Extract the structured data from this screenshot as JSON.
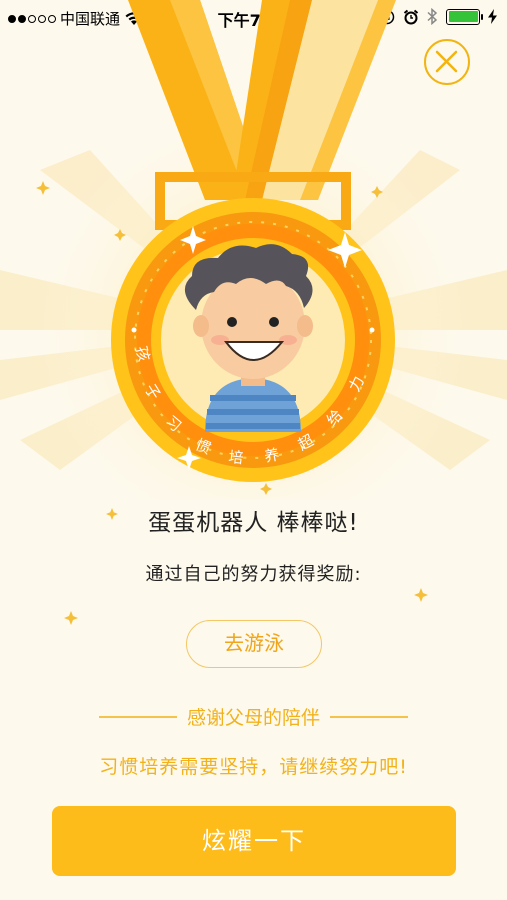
{
  "status_bar": {
    "carrier": "中国联通",
    "time": "下午7:34",
    "signal_dots_filled": 2,
    "signal_dots_total": 5,
    "icons": [
      "wifi-icon",
      "orientation-lock-icon",
      "alarm-icon",
      "bluetooth-icon",
      "battery-icon",
      "charging-icon"
    ]
  },
  "close_icon": "close-icon",
  "medal": {
    "ring_text": [
      "孩",
      "子",
      "习",
      "惯",
      "培",
      "养",
      "超",
      "给",
      "力"
    ],
    "colors": {
      "ribbon": "#fbb217",
      "ribbon_light": "#fde3a0",
      "ring": "#f99a0e",
      "gold": "#ffc31a",
      "inner": "#fdeab2"
    }
  },
  "award_line": "蛋蛋机器人 棒棒哒!",
  "subtitle": "通过自己的努力获得奖励:",
  "reward": "去游泳",
  "thanks": "感谢父母的陪伴",
  "encourage": "习惯培养需要坚持，请继续努力吧!",
  "share_button": "炫耀一下"
}
